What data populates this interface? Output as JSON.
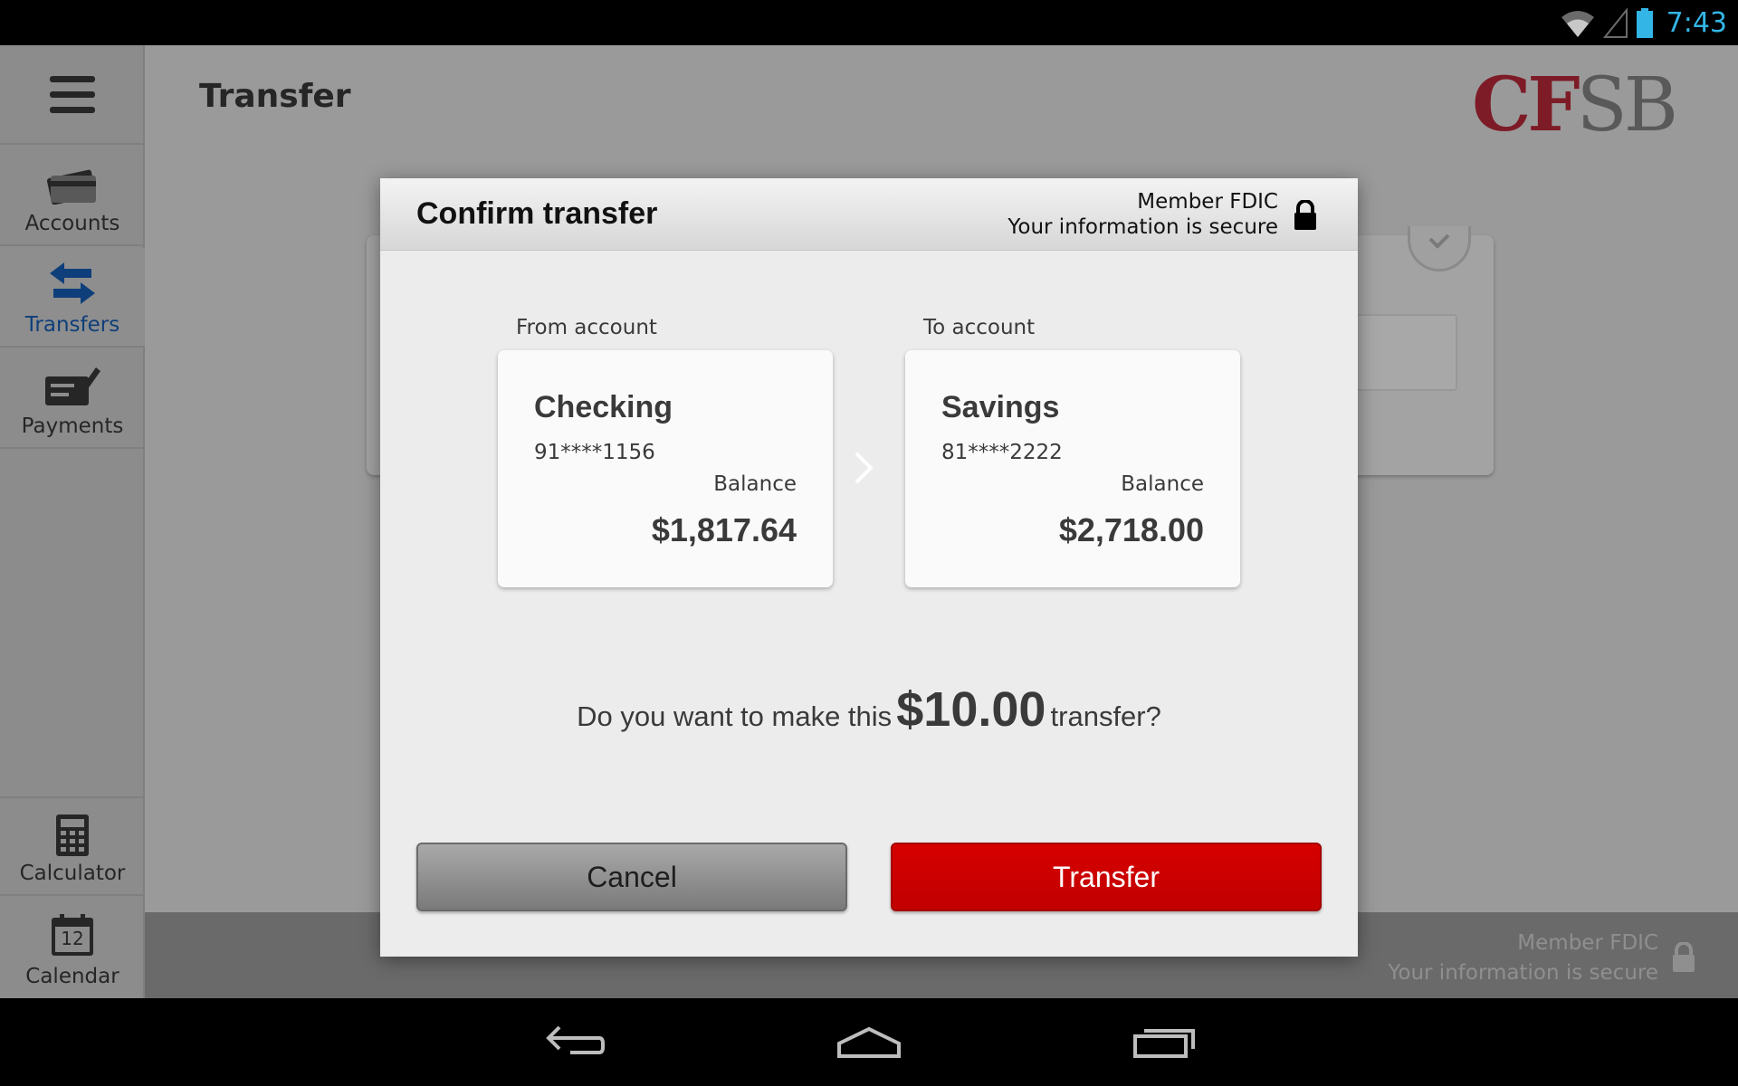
{
  "status_bar": {
    "time": "7:43",
    "icons": [
      "wifi-icon",
      "signal-icon",
      "battery-icon"
    ]
  },
  "sidebar": {
    "items": [
      {
        "label": "Accounts",
        "icon": "credit-card-icon"
      },
      {
        "label": "Transfers",
        "icon": "transfer-arrows-icon",
        "active": true
      },
      {
        "label": "Payments",
        "icon": "check-pen-icon"
      }
    ],
    "bottom_items": [
      {
        "label": "Calculator",
        "icon": "calculator-icon"
      },
      {
        "label": "Calendar",
        "icon": "calendar-icon",
        "icon_text": "12"
      }
    ]
  },
  "header": {
    "title": "Transfer",
    "logo": {
      "part1": "CF",
      "part2": "SB"
    }
  },
  "footer": {
    "line1": "Member FDIC",
    "line2": "Your information is secure"
  },
  "modal": {
    "title": "Confirm transfer",
    "secure_line1": "Member FDIC",
    "secure_line2": "Your information is secure",
    "from": {
      "label": "From account",
      "name": "Checking",
      "number": "91****1156",
      "balance_label": "Balance",
      "balance": "$1,817.64"
    },
    "to": {
      "label": "To account",
      "name": "Savings",
      "number": "81****2222",
      "balance_label": "Balance",
      "balance": "$2,718.00"
    },
    "question_prefix": "Do you want to make this",
    "amount": "$10.00",
    "question_suffix": "transfer?",
    "cancel_label": "Cancel",
    "transfer_label": "Transfer"
  },
  "colors": {
    "accent_red": "#cc0000",
    "active_nav": "#0f3f7a",
    "clock": "#33b5e5",
    "logo_red": "#7d1b26"
  }
}
